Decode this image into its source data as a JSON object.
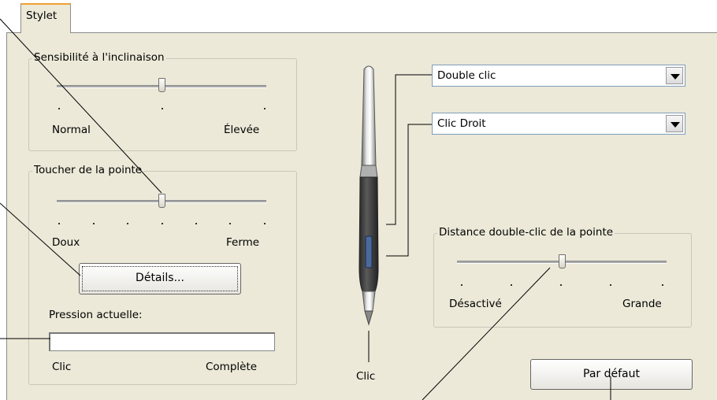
{
  "tab": {
    "label": "Stylet"
  },
  "tilt_group": {
    "title": "Sensibilité à l'inclinaison",
    "slider_fraction": 0.5,
    "min_label": "Normal",
    "max_label": "Élevée"
  },
  "tip_group": {
    "title": "Toucher de la pointe",
    "slider_fraction": 0.5,
    "min_label": "Doux",
    "max_label": "Ferme",
    "details_button": "Détails...",
    "pressure_label": "Pression actuelle:",
    "pressure_fraction": 0,
    "click_label": "Clic",
    "full_label": "Complète"
  },
  "pen": {
    "upper_button_value": "Double clic",
    "lower_button_value": "Clic Droit",
    "tip_label": "Clic"
  },
  "double_click_group": {
    "title": "Distance double-clic de la pointe",
    "slider_fraction": 0.5,
    "min_label": "Désactivé",
    "max_label": "Grande"
  },
  "default_button": "Par défaut"
}
